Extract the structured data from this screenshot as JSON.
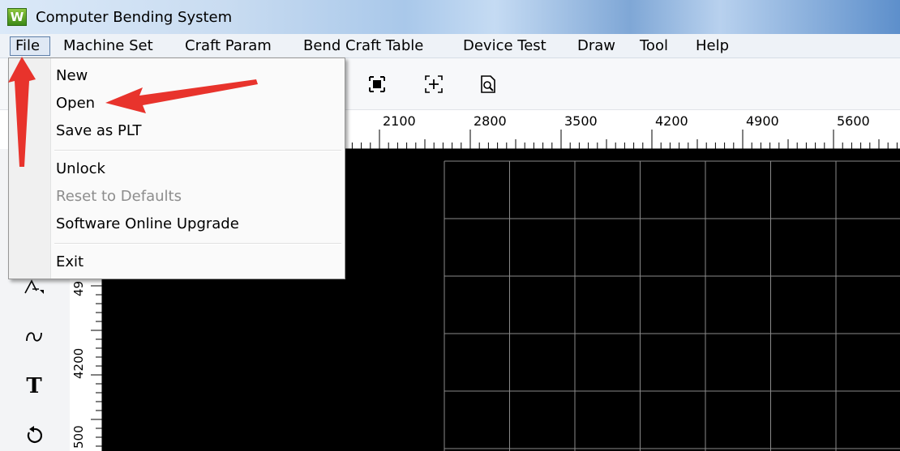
{
  "window": {
    "icon_letter": "W",
    "title": "Computer Bending System"
  },
  "menubar": {
    "items": [
      {
        "label": "File"
      },
      {
        "label": "Machine Set"
      },
      {
        "label": "Craft Param"
      },
      {
        "label": "Bend Craft Table"
      },
      {
        "label": "Device Test"
      },
      {
        "label": "Draw"
      },
      {
        "label": "Tool"
      },
      {
        "label": "Help"
      }
    ]
  },
  "file_menu": {
    "items": [
      {
        "label": "New",
        "enabled": true
      },
      {
        "label": "Open",
        "enabled": true
      },
      {
        "label": "Save as PLT",
        "enabled": true
      },
      {
        "label": "Unlock",
        "enabled": true
      },
      {
        "label": "Reset to Defaults",
        "enabled": false
      },
      {
        "label": "Software Online Upgrade",
        "enabled": true
      },
      {
        "label": "Exit",
        "enabled": true
      }
    ]
  },
  "toolbar": {
    "icons": [
      "fit-selection-icon",
      "zoom-center-icon",
      "page-preview-icon"
    ]
  },
  "ruler_h": {
    "labels": [
      "2100",
      "2800",
      "3500",
      "4200",
      "4900",
      "5600"
    ]
  },
  "ruler_v": {
    "labels": [
      "49",
      "4200",
      "500"
    ]
  },
  "left_tools": {
    "icons": [
      "polyline-tool-icon",
      "curve-tool-icon",
      "text-tool-icon",
      "rotate-tool-icon"
    ],
    "text_tool_label": "T"
  },
  "colors": {
    "canvas": "#000000",
    "grid": "#8a8a8a",
    "annotation_arrow": "#e8332c"
  }
}
